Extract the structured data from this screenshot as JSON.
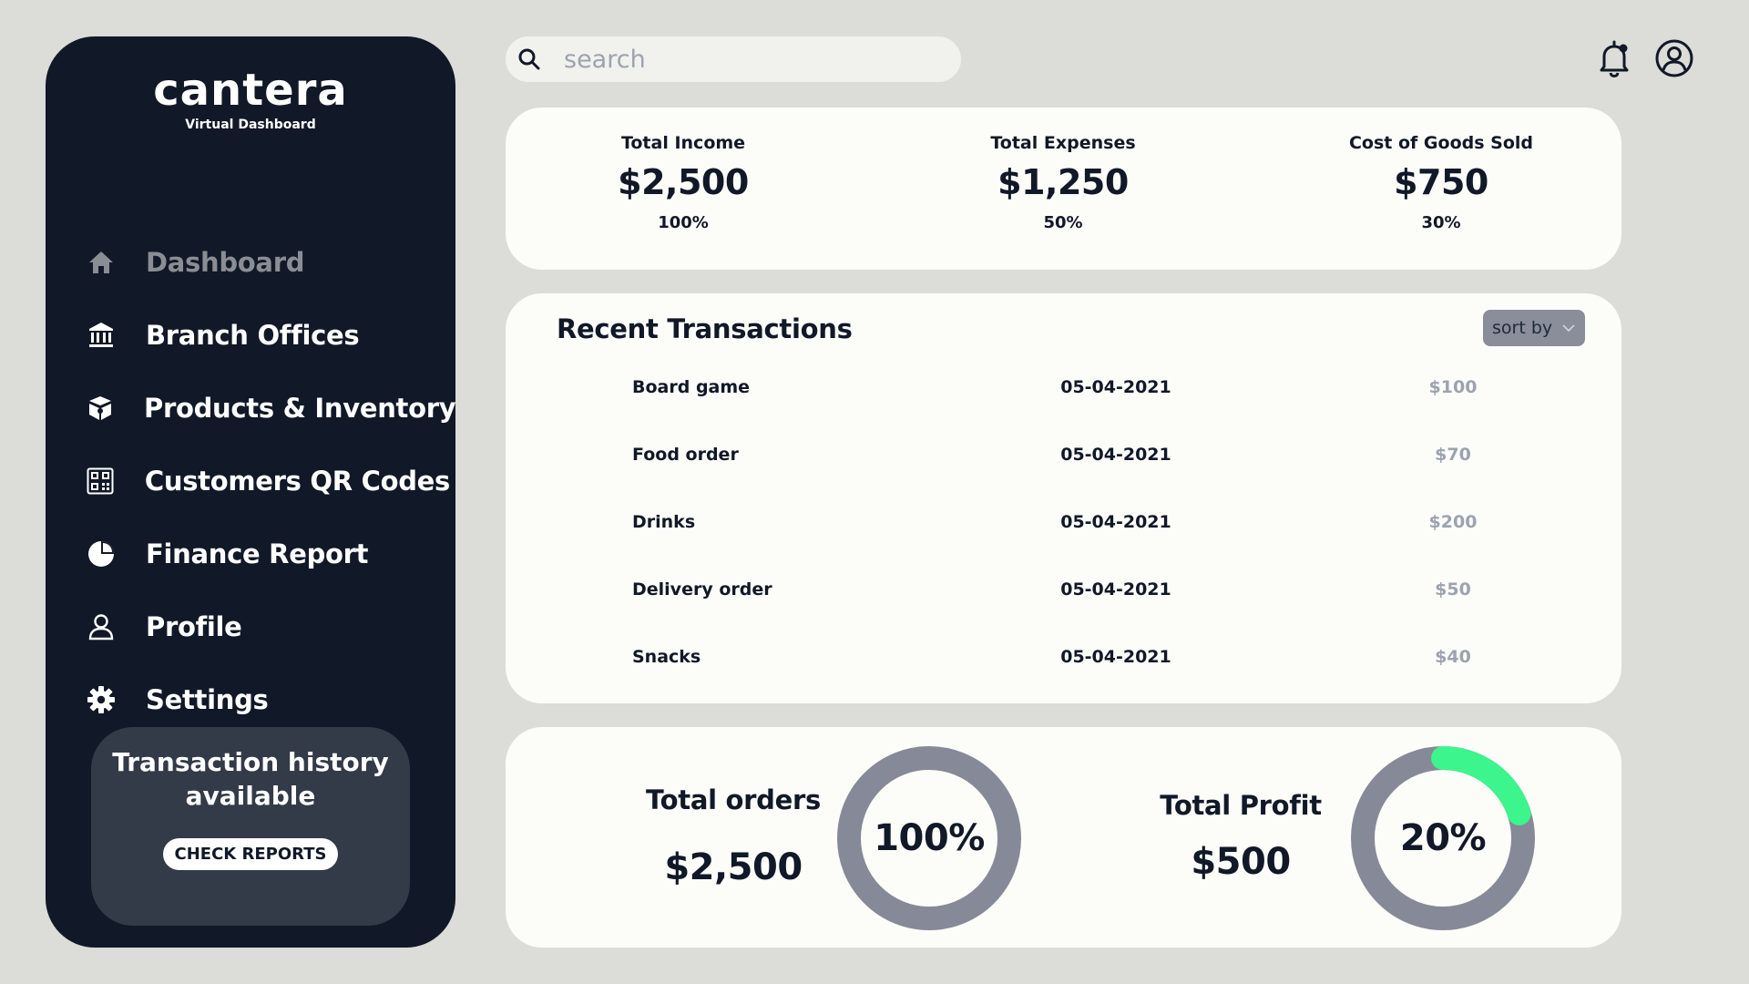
{
  "sidebar": {
    "brand": {
      "name": "cantera",
      "tagline": "Virtual Dashboard"
    },
    "items": [
      {
        "label": "Dashboard",
        "icon": "home-icon"
      },
      {
        "label": "Branch Offices",
        "icon": "bank-icon"
      },
      {
        "label": "Products & Inventory",
        "icon": "box-icon"
      },
      {
        "label": "Customers QR Codes",
        "icon": "qr-code-icon"
      },
      {
        "label": "Finance Report",
        "icon": "pie-chart-icon"
      },
      {
        "label": "Profile",
        "icon": "person-icon"
      },
      {
        "label": "Settings",
        "icon": "gear-icon"
      }
    ],
    "promo": {
      "title": "Transaction history available",
      "button": "CHECK REPORTS"
    }
  },
  "search": {
    "placeholder": "search"
  },
  "stats": [
    {
      "label": "Total Income",
      "value": "$2,500",
      "percent": "100%"
    },
    {
      "label": "Total Expenses",
      "value": "$1,250",
      "percent": "50%"
    },
    {
      "label": "Cost of Goods Sold",
      "value": "$750",
      "percent": "30%"
    }
  ],
  "transactions": {
    "title": "Recent Transactions",
    "sort_label": "sort by",
    "rows": [
      {
        "name": "Board game",
        "date": "05-04-2021",
        "amount": "$100"
      },
      {
        "name": "Food order",
        "date": "05-04-2021",
        "amount": "$70"
      },
      {
        "name": "Drinks",
        "date": "05-04-2021",
        "amount": "$200"
      },
      {
        "name": "Delivery order",
        "date": "05-04-2021",
        "amount": "$50"
      },
      {
        "name": "Snacks",
        "date": "05-04-2021",
        "amount": "$40"
      }
    ]
  },
  "summary": {
    "orders": {
      "label": "Total orders",
      "value": "$2,500",
      "percent_label": "100%"
    },
    "profit": {
      "label": "Total Profit",
      "value": "$500",
      "percent_label": "20%",
      "progress": 0.2
    }
  },
  "colors": {
    "sidebar_bg": "#111827",
    "page_bg": "#dcdcd8",
    "card_bg": "#fcfcf9",
    "ring_track": "#868997",
    "ring_accent": "#3cf58c",
    "muted_text": "#9ca3af",
    "active_nav": "#8a8d94"
  }
}
